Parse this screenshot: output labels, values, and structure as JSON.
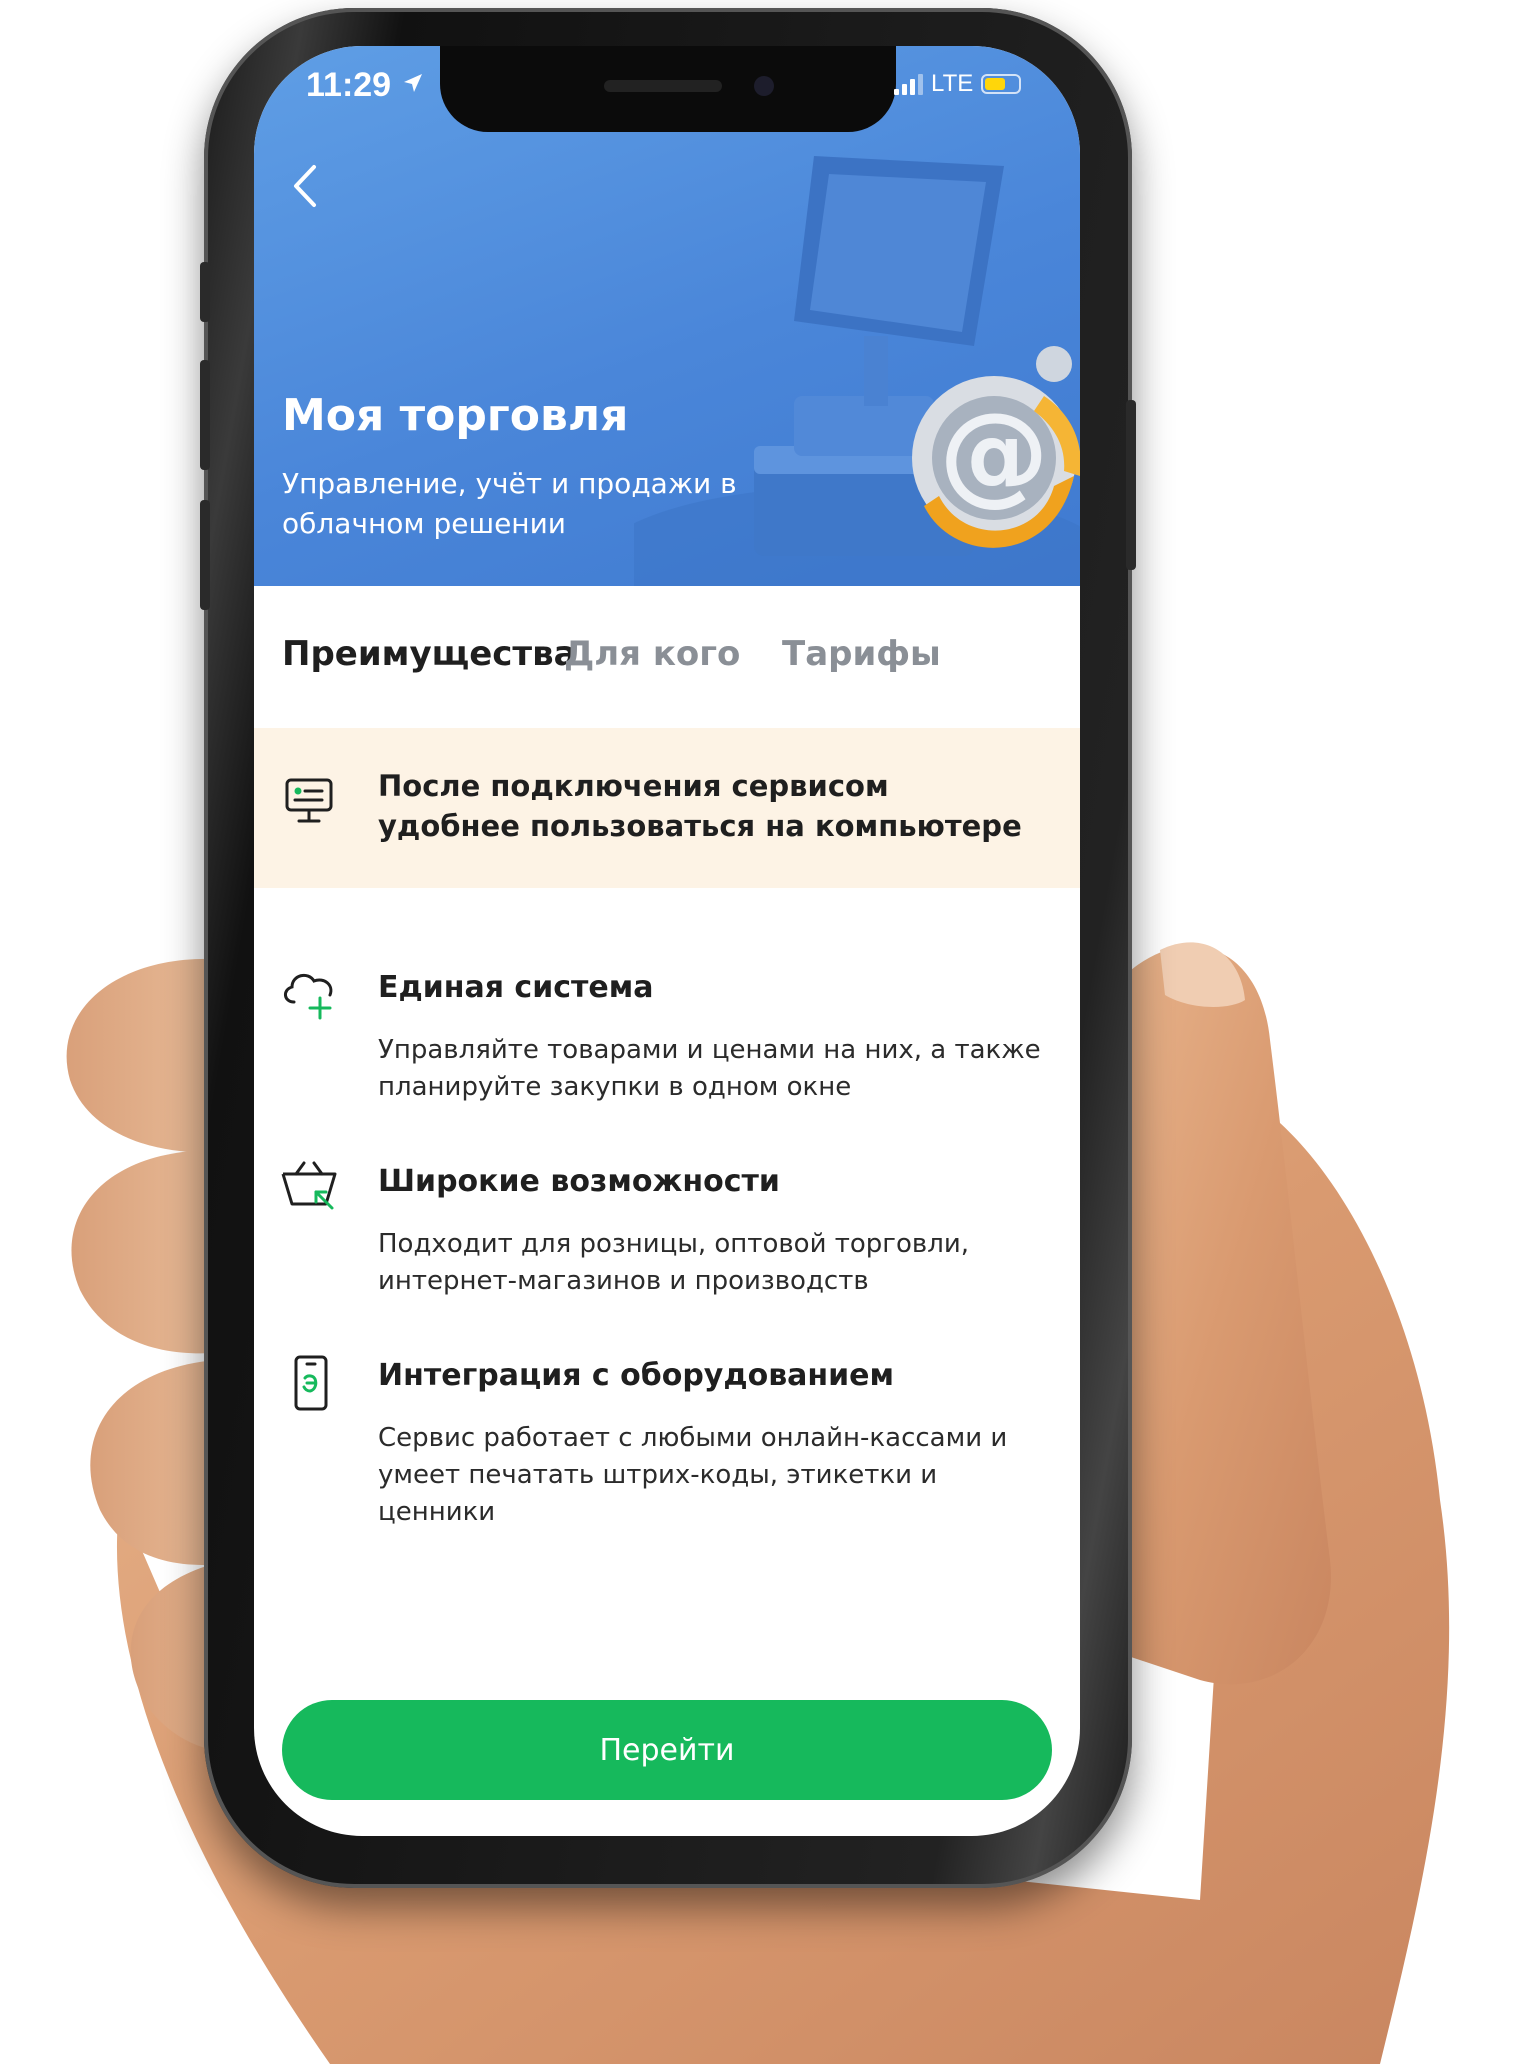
{
  "status_bar": {
    "time": "11:29",
    "network": "LTE"
  },
  "header": {
    "title": "Моя торговля",
    "subtitle": "Управление, учёт и продажи в облачном решении"
  },
  "tabs": [
    {
      "label": "Преимущества",
      "active": true
    },
    {
      "label": "Для кого",
      "active": false
    },
    {
      "label": "Тарифы",
      "active": false
    }
  ],
  "notice": {
    "text": "После подключения сервисом удобнее пользоваться на компьютере"
  },
  "features": [
    {
      "icon": "cloud-plus-icon",
      "title": "Единая система",
      "description": "Управляйте товарами и ценами на них, а также планируйте закупки в одном окне"
    },
    {
      "icon": "basket-arrow-icon",
      "title": "Широкие возможности",
      "description": "Подходит для розницы, оптовой торговли, интернет-магазинов и производств"
    },
    {
      "icon": "phone-receipt-icon",
      "title": "Интеграция с оборудованием",
      "description": "Сервис работает с любыми онлайн-кассами и умеет печатать штрих-коды, этикетки и ценники"
    }
  ],
  "cta": {
    "label": "Перейти"
  },
  "colors": {
    "hero_blue": "#4a86d9",
    "notice_bg": "#fdf3e5",
    "accent_green": "#16b95c",
    "battery_yellow": "#ffd60a"
  }
}
